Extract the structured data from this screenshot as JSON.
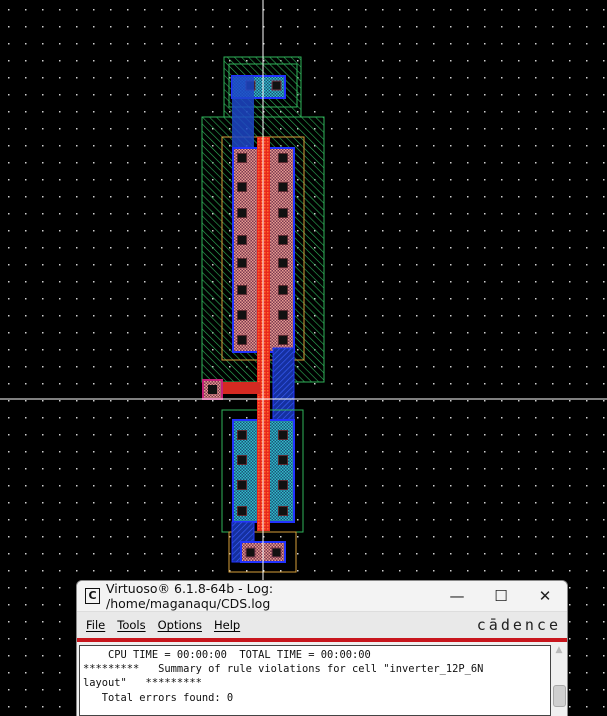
{
  "window": {
    "title": "Virtuoso® 6.1.8-64b - Log: /home/maganaqu/CDS.log",
    "icon": "cadence-c-icon",
    "controls": {
      "minimize": "—",
      "maximize": "☐",
      "close": "✕"
    },
    "menu": [
      "File",
      "Tools",
      "Options",
      "Help"
    ],
    "logo": "cādence",
    "log_lines": [
      "    CPU TIME = 00:00:00  TOTAL TIME = 00:00:00",
      "*********   Summary of rule violations for cell \"inverter_12P_6N",
      "layout\"   *********",
      "   Total errors found: 0"
    ]
  },
  "colors": {
    "nwell": "#2fb35a",
    "poly": "#e8281c",
    "metal1": "#2233ff",
    "pdiff": "#c8707a",
    "ndiff": "#21a6b8",
    "select": "#d9a03a"
  }
}
